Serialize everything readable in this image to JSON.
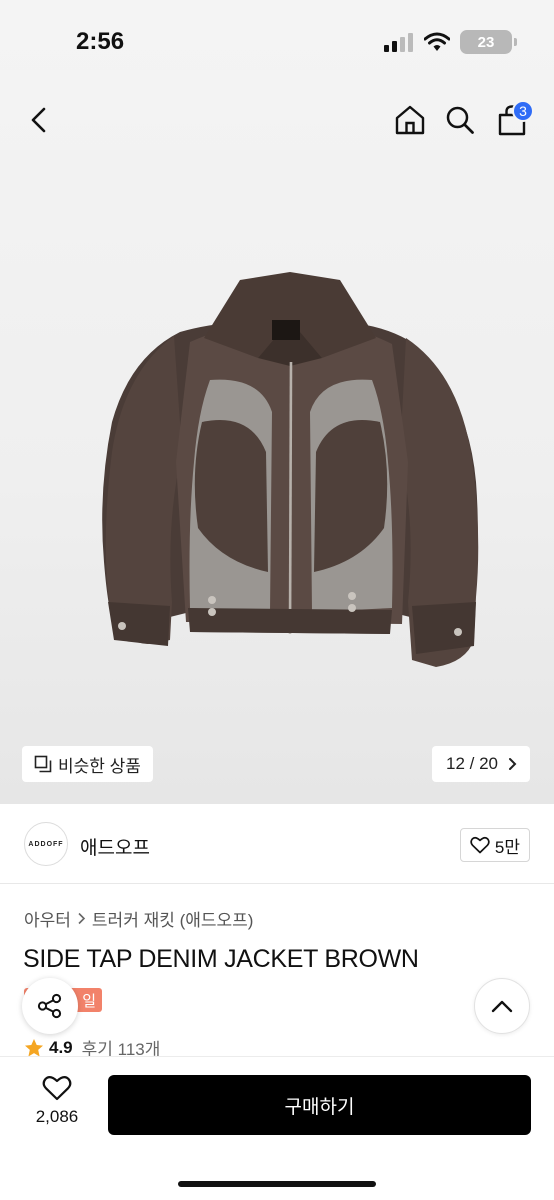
{
  "status_bar": {
    "time": "2:56",
    "battery": "23"
  },
  "nav": {
    "cart_count": "3"
  },
  "gallery": {
    "similar_label": "비슷한 상품",
    "counter": "12 / 20"
  },
  "brand": {
    "logo_text": "ADDOFF",
    "name": "애드오프",
    "like_count": "5만"
  },
  "breadcrumb": {
    "category": "아우터",
    "subcategory": "트러커 재킷 (애드오프)"
  },
  "product": {
    "title": "SIDE TAP DENIM JACKET BROWN",
    "sale_tag": "일",
    "rating": "4.9",
    "review_label": "후기 113개"
  },
  "bottom_bar": {
    "wish_count": "2,086",
    "buy_label": "구매하기"
  },
  "colors": {
    "accent_badge": "#2f6cf6",
    "sale_tag": "#f2826a",
    "buy_button": "#000000",
    "star": "#f5a623"
  },
  "icons": [
    "back-arrow-icon",
    "home-icon",
    "search-icon",
    "cart-icon",
    "similar-icon",
    "chevron-right-icon",
    "heart-icon",
    "share-icon",
    "chevron-up-icon",
    "star-icon"
  ]
}
